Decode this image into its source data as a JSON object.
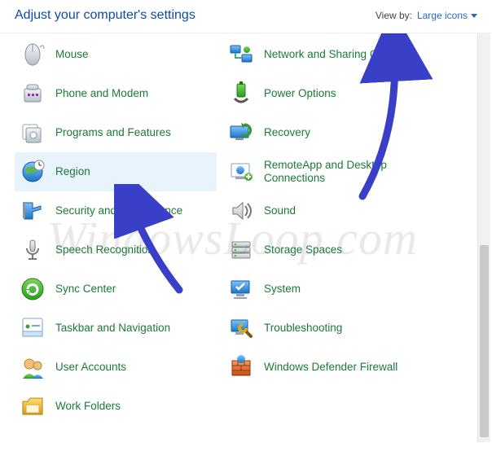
{
  "header": {
    "title": "Adjust your computer's settings",
    "viewby_label": "View by:",
    "viewby_value": "Large icons"
  },
  "watermark": "WindowsLoop.com",
  "left_items": [
    {
      "icon": "mouse-icon",
      "label": "Mouse",
      "selected": false
    },
    {
      "icon": "phone-modem-icon",
      "label": "Phone and Modem",
      "selected": false
    },
    {
      "icon": "programs-features-icon",
      "label": "Programs and Features",
      "selected": false
    },
    {
      "icon": "region-icon",
      "label": "Region",
      "selected": true
    },
    {
      "icon": "security-maintenance-icon",
      "label": "Security and Maintenance",
      "selected": false
    },
    {
      "icon": "speech-recognition-icon",
      "label": "Speech Recognition",
      "selected": false
    },
    {
      "icon": "sync-center-icon",
      "label": "Sync Center",
      "selected": false
    },
    {
      "icon": "taskbar-navigation-icon",
      "label": "Taskbar and Navigation",
      "selected": false
    },
    {
      "icon": "user-accounts-icon",
      "label": "User Accounts",
      "selected": false
    },
    {
      "icon": "work-folders-icon",
      "label": "Work Folders",
      "selected": false
    }
  ],
  "right_items": [
    {
      "icon": "network-sharing-icon",
      "label": "Network and Sharing Center",
      "selected": false
    },
    {
      "icon": "power-options-icon",
      "label": "Power Options",
      "selected": false
    },
    {
      "icon": "recovery-icon",
      "label": "Recovery",
      "selected": false
    },
    {
      "icon": "remoteapp-icon",
      "label": "RemoteApp and Desktop Connections",
      "selected": false
    },
    {
      "icon": "sound-icon",
      "label": "Sound",
      "selected": false
    },
    {
      "icon": "storage-spaces-icon",
      "label": "Storage Spaces",
      "selected": false
    },
    {
      "icon": "system-icon",
      "label": "System",
      "selected": false
    },
    {
      "icon": "troubleshooting-icon",
      "label": "Troubleshooting",
      "selected": false
    },
    {
      "icon": "defender-firewall-icon",
      "label": "Windows Defender Firewall",
      "selected": false
    }
  ]
}
